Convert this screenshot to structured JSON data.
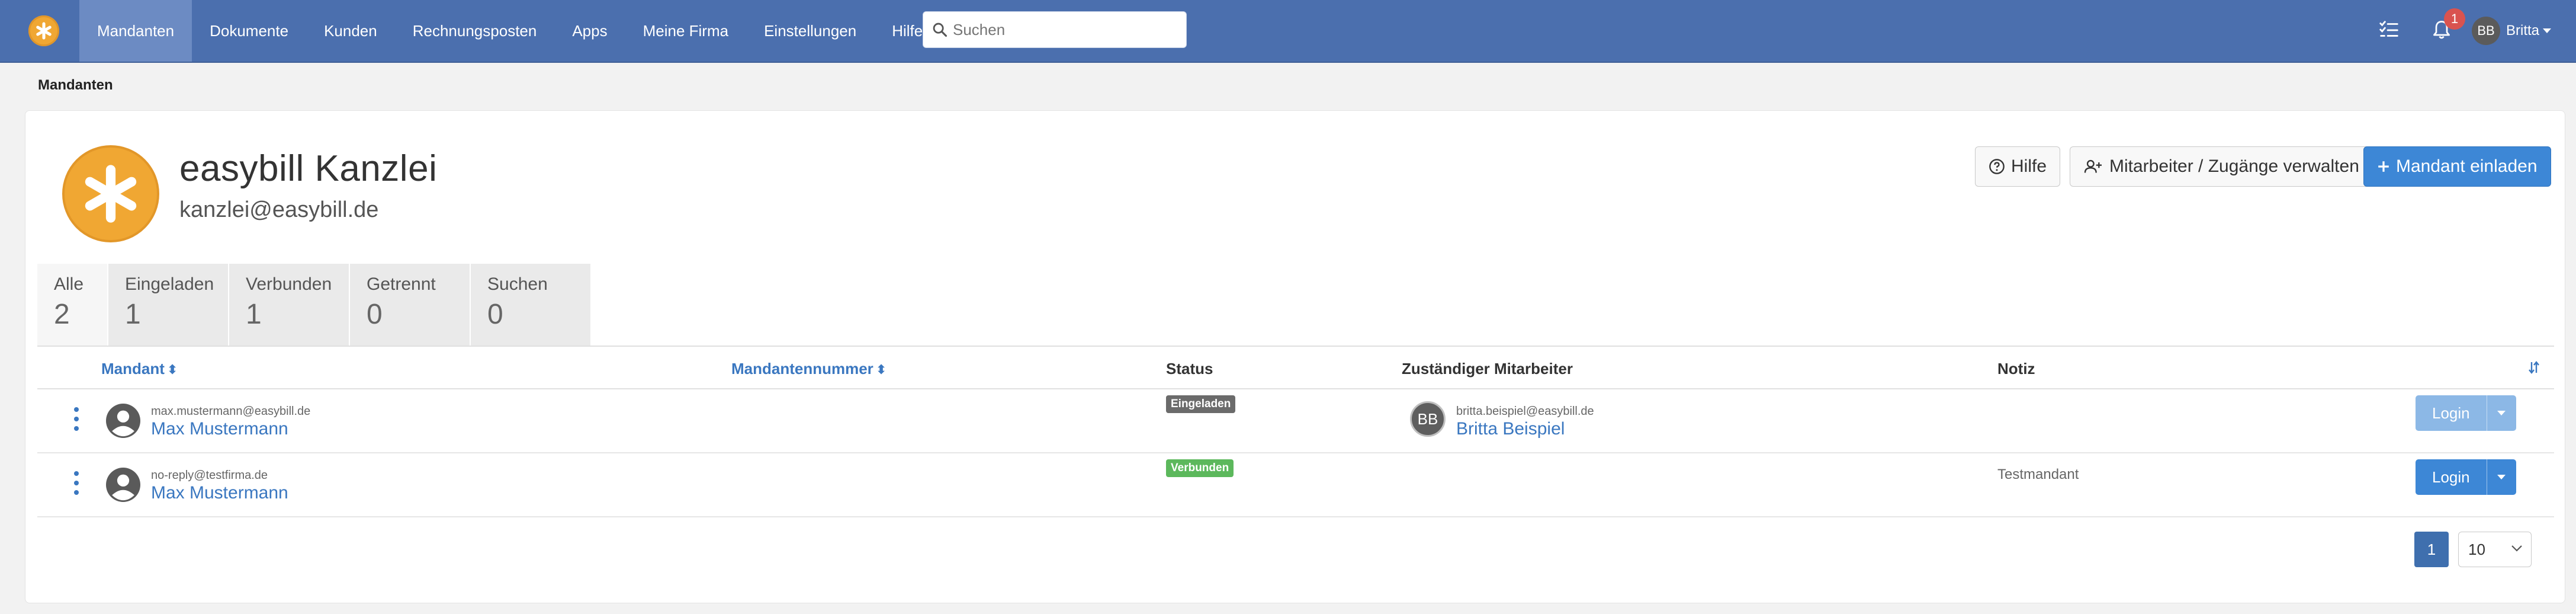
{
  "nav": {
    "items": [
      {
        "label": "Mandanten",
        "active": true
      },
      {
        "label": "Dokumente"
      },
      {
        "label": "Kunden"
      },
      {
        "label": "Rechnungsposten"
      },
      {
        "label": "Apps"
      },
      {
        "label": "Meine Firma"
      },
      {
        "label": "Einstellungen"
      },
      {
        "label": "Hilfe?"
      }
    ],
    "search_placeholder": "Suchen",
    "notification_count": "1",
    "user_initials": "BB",
    "user_name": "Britta",
    "colors": {
      "bar": "#4b6fae",
      "active": "#6c8bc3",
      "brand": "#f0a733"
    }
  },
  "breadcrumb": "Mandanten",
  "header": {
    "company_name": "easybill Kanzlei",
    "company_email": "kanzlei@easybill.de",
    "buttons": {
      "help": "Hilfe",
      "staff": "Mitarbeiter / Zugänge verwalten",
      "invite": "Mandant einladen"
    }
  },
  "tabs": [
    {
      "label": "Alle",
      "count": "2",
      "active": true
    },
    {
      "label": "Eingeladen",
      "count": "1"
    },
    {
      "label": "Verbunden",
      "count": "1"
    },
    {
      "label": "Getrennt",
      "count": "0"
    },
    {
      "label": "Suchen",
      "count": "0"
    }
  ],
  "table": {
    "columns": {
      "client": "Mandant",
      "client_number": "Mandantennummer",
      "status": "Status",
      "staff": "Zuständiger Mitarbeiter",
      "note": "Notiz"
    },
    "rows": [
      {
        "email": "max.mustermann@easybill.de",
        "name": "Max Mustermann",
        "status": "Eingeladen",
        "status_color": "#6b6b6b",
        "staff_initials": "BB",
        "staff_email": "britta.beispiel@easybill.de",
        "staff_name": "Britta Beispiel",
        "note": "",
        "login": "Login",
        "login_enabled": false
      },
      {
        "email": "no-reply@testfirma.de",
        "name": "Max Mustermann",
        "status": "Verbunden",
        "status_color": "#5cb85c",
        "note": "Testmandant",
        "login": "Login",
        "login_enabled": true
      }
    ]
  },
  "pagination": {
    "current_page": "1",
    "page_size": "10"
  }
}
